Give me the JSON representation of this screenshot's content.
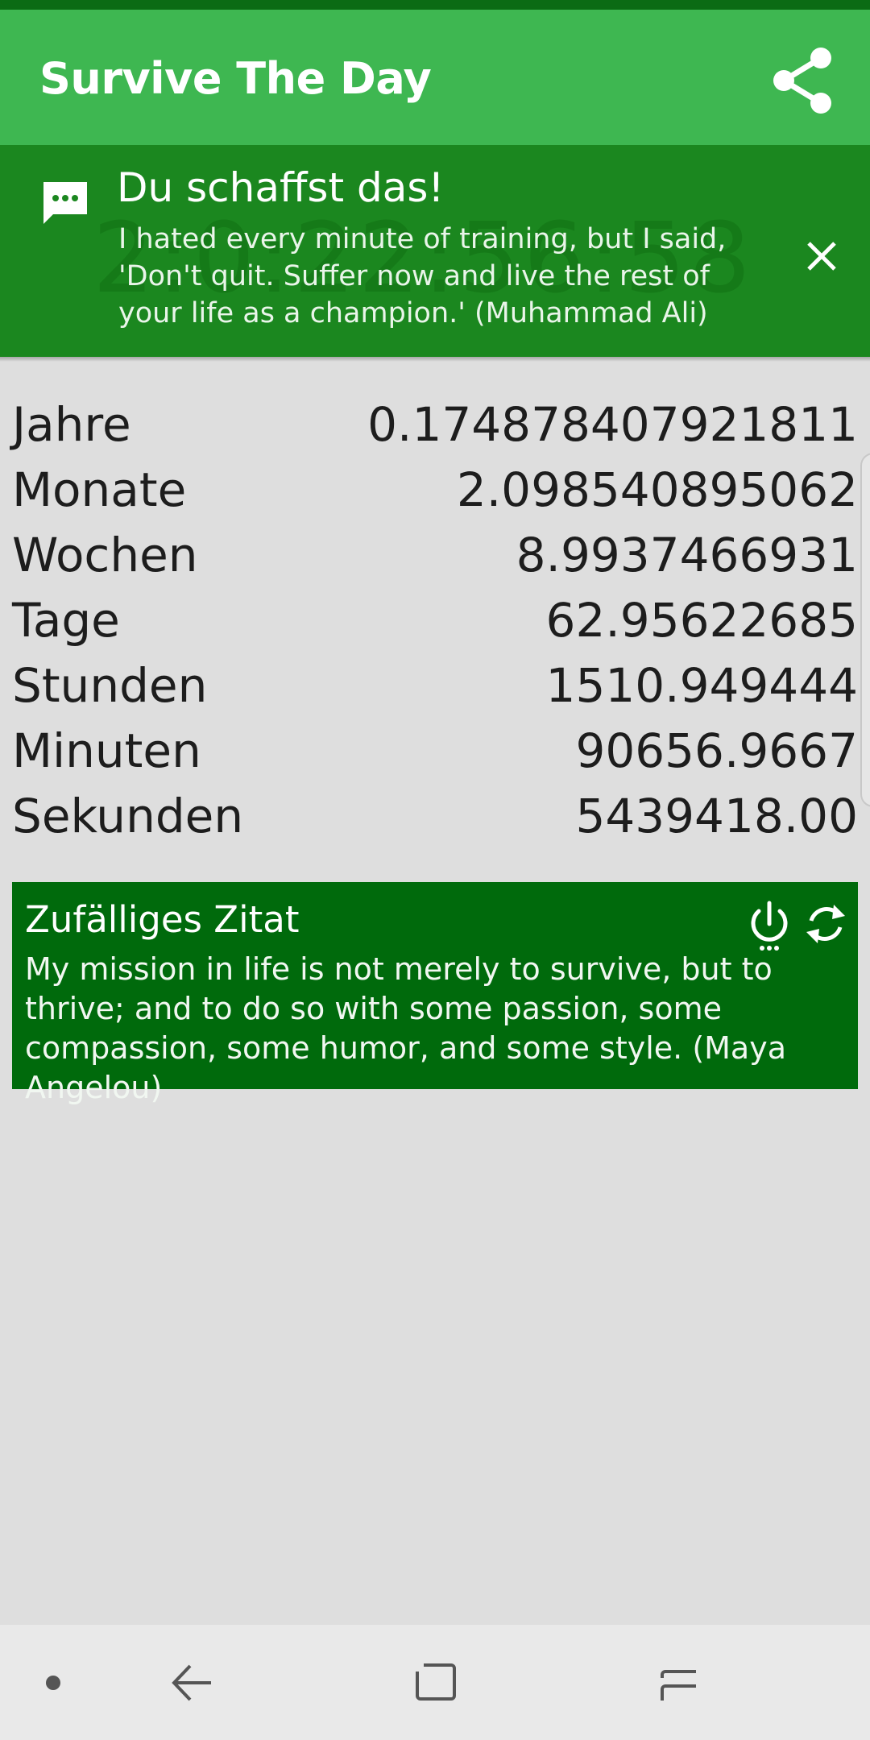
{
  "app_bar": {
    "title": "Survive The Day",
    "share_icon": "share-icon"
  },
  "banner": {
    "title": "Du schaffst das!",
    "message": "I hated every minute of training, but I said, 'Don't quit. Suffer now and live the rest of your life as a champion.' (Muhammad Ali)",
    "background_time": "2:0:22:56:58",
    "message_icon": "message-icon",
    "close_icon": "close-icon"
  },
  "stats": [
    {
      "label": "Jahre",
      "value": "0.174878407921811"
    },
    {
      "label": "Monate",
      "value": "2.098540895062"
    },
    {
      "label": "Wochen",
      "value": "8.9937466931"
    },
    {
      "label": "Tage",
      "value": "62.95622685"
    },
    {
      "label": "Stunden",
      "value": "1510.949444"
    },
    {
      "label": "Minuten",
      "value": "90656.9667"
    },
    {
      "label": "Sekunden",
      "value": "5439418.00"
    }
  ],
  "quote_card": {
    "title": "Zufälliges Zitat",
    "text": "My mission in life is not merely to survive, but to thrive; and to do so with some passion, some compassion, some humor, and some style. (Maya Angelou)",
    "power_icon": "power-icon",
    "refresh_icon": "refresh-icon"
  },
  "nav_bar": {
    "items": [
      "dot-icon",
      "back-icon",
      "home-icon",
      "recents-icon"
    ]
  },
  "colors": {
    "app_bar": "#3eb751",
    "banner": "#1b871f",
    "quote_card": "#006a0c",
    "background": "#dedede"
  }
}
